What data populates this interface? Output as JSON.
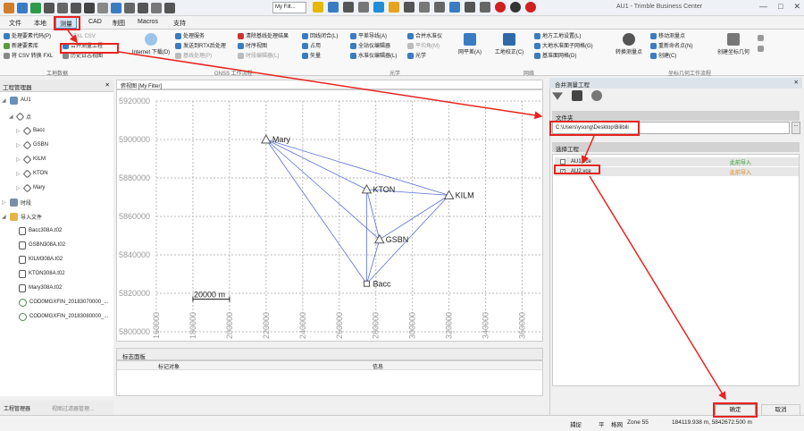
{
  "titlebar": {
    "window_title": "AU1 - Trimble Business Center",
    "filter_label": "My Filt...",
    "controls": {
      "minimize": "—",
      "maximize": "□",
      "close": "✕"
    }
  },
  "menu": [
    "文件",
    "本地",
    "测量",
    "CAD",
    "制图",
    "Macros",
    "支持"
  ],
  "ribbon": {
    "col1": [
      "处理要素代码(P)",
      "新建要素库",
      "将 CSV 转换 FXL"
    ],
    "fxl_csv": "FXL CSV",
    "merge": "合并测量工程",
    "history": "历史日志视图",
    "internet": "Internet 下载(D)",
    "process": [
      "处理服务",
      "发送到RTX后处理",
      "基线处理(P)"
    ],
    "clear": [
      "清除基线处理结果",
      "时序视图",
      "时段编辑器(L)"
    ],
    "loop": [
      "回线闭合(L)",
      "占用",
      "矢量"
    ],
    "level": [
      "平差导线(A)",
      "全站仪编辑器",
      "水准仪编辑器(L)"
    ],
    "merge_level": [
      "合并水准仪",
      "平均角(M)",
      "光学"
    ],
    "adjust": "网平差(A)",
    "calib": "工地校正(C)",
    "local": [
      "地方工地设置(L)",
      "大地水准面子网格(G)",
      "基准面网格(D)"
    ],
    "convert": "转换测量点",
    "move": [
      "移动测量点",
      "重新命名点(N)",
      "创建(C)"
    ],
    "create_geo": "创建坐标几何",
    "groups": [
      "工地数据",
      "GNSS 工作流程",
      "光学",
      "网络",
      "坐标几何工作流程"
    ]
  },
  "project_panel": {
    "header": "工程管理器",
    "root": "AU1",
    "points_label": "点",
    "points": [
      "Bacc",
      "GSBN",
      "KILM",
      "KTON",
      "Mary"
    ],
    "sessions_label": "时段",
    "imported_label": "导入文件",
    "files": [
      "Bacc308A.t02",
      "GSBN308A.t02",
      "KILM308A.t02",
      "KTON308A.t02",
      "Mary308A.t02",
      "COD0MGXFIN_20183070000_...",
      "COD0MGXFIN_20183080000_..."
    ],
    "tabs": [
      "工程管理器",
      "视图过滤器管理..."
    ]
  },
  "map": {
    "header": "俯视图 [My Filter]",
    "y_ticks": [
      "5920000",
      "5900000",
      "5880000",
      "5860000",
      "5840000",
      "5820000",
      "5800000"
    ],
    "x_ticks": [
      "160000",
      "180000",
      "200000",
      "220000",
      "240000",
      "260000",
      "280000",
      "300000",
      "320000",
      "340000",
      "360000"
    ],
    "scale_label": "20000 m",
    "stations": [
      {
        "id": "Mary",
        "e": 220000,
        "n": 5900000,
        "sym": "triangle"
      },
      {
        "id": "KTON",
        "e": 275000,
        "n": 5874000,
        "sym": "triangle"
      },
      {
        "id": "KILM",
        "e": 320000,
        "n": 5871000,
        "sym": "triangle"
      },
      {
        "id": "GSBN",
        "e": 282000,
        "n": 5848000,
        "sym": "triangle"
      },
      {
        "id": "Bacc",
        "e": 275000,
        "n": 5825000,
        "sym": "square"
      }
    ],
    "lines": [
      [
        "Mary",
        "KTON"
      ],
      [
        "Mary",
        "KILM"
      ],
      [
        "Mary",
        "GSBN"
      ],
      [
        "Mary",
        "Bacc"
      ],
      [
        "KTON",
        "KILM"
      ],
      [
        "KTON",
        "GSBN"
      ],
      [
        "KTON",
        "Bacc"
      ],
      [
        "KILM",
        "GSBN"
      ],
      [
        "KILM",
        "Bacc"
      ],
      [
        "GSBN",
        "Bacc"
      ]
    ],
    "line_color": "#5b6fd6"
  },
  "event_panel": {
    "header": "标志面板",
    "columns": [
      "标记对象",
      "信息"
    ]
  },
  "merge_panel": {
    "title": "合并测量工程",
    "folder_label": "文件夹",
    "path": "C:\\Users\\ysong\\Desktop\\Bilibili",
    "browse": "...",
    "select_label": "选择工程",
    "projects": [
      {
        "name": "AU1.vce",
        "checked": false,
        "status": "此前导入",
        "status_color": "#2e9a2e"
      },
      {
        "name": "AU2.vce",
        "checked": true,
        "status": "此前导入",
        "status_color": "#e08a1e"
      }
    ],
    "ok": "确定",
    "cancel": "取消"
  },
  "status": {
    "items": [
      "捕捉",
      "平",
      "格网",
      "Zone 55"
    ],
    "coords": "184119.938 m, 5842672.500 m"
  },
  "accent": "#e8231e"
}
